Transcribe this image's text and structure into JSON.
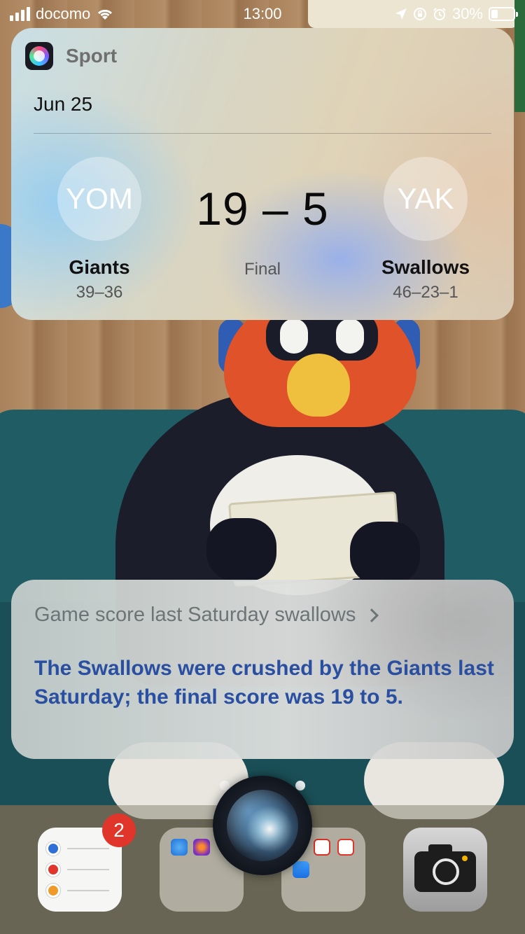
{
  "status_bar": {
    "carrier": "docomo",
    "time": "13:00",
    "battery_percent": "30%",
    "battery_level": 0.3,
    "icons": [
      "signal-icon",
      "wifi-icon",
      "location-icon",
      "orientation-lock-icon",
      "alarm-icon",
      "battery-icon"
    ]
  },
  "sport_card": {
    "app_name": "Sport",
    "app_icon": "siri-icon",
    "date": "Jun 25",
    "home_team": {
      "abbr": "YOM",
      "name": "Giants",
      "record": "39–36"
    },
    "away_team": {
      "abbr": "YAK",
      "name": "Swallows",
      "record": "46–23–1"
    },
    "score": "19 – 5",
    "status": "Final"
  },
  "siri_response": {
    "query": "Game score last Saturday swallows",
    "answer": "The Swallows were crushed by the Giants last Saturday; the final score was 19 to 5."
  },
  "dock": {
    "reminders_badge": "2",
    "apps": [
      "reminders-app",
      "folder-app",
      "folder-app",
      "camera-app"
    ]
  },
  "colors": {
    "answer_text": "#2a4fa0",
    "badge": "#e0352b"
  }
}
